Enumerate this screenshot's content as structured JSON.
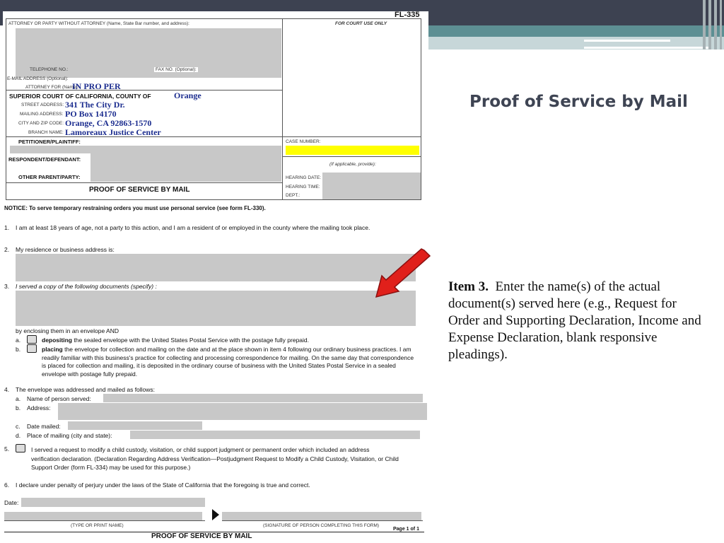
{
  "slide": {
    "title": "Proof of Service by Mail",
    "note_bold": "Item 3.",
    "note_text": "Enter the name(s) of the actual document(s) served here (e.g., Request for Order and Supporting Declaration, Income and Expense Declaration, blank responsive pleadings)."
  },
  "form": {
    "form_number": "FL-335",
    "header": {
      "attorney_label": "ATTORNEY OR PARTY WITHOUT ATTORNEY (Name, State Bar number, and address):",
      "court_use_label": "FOR COURT USE ONLY",
      "telephone_label": "TELEPHONE NO.:",
      "fax_label": "FAX NO. (Optional):",
      "email_label": "E-MAIL ADDRESS (Optional):",
      "attorney_for_label": "ATTORNEY FOR (Name):",
      "attorney_for_value": "IN PRO PER",
      "court_label": "SUPERIOR COURT OF CALIFORNIA, COUNTY OF",
      "county_value": "Orange",
      "street_label": "STREET ADDRESS:",
      "street_value": "341 The City Dr.",
      "mailing_label": "MAILING ADDRESS:",
      "mailing_value": "PO Box 14170",
      "city_label": "CITY AND ZIP CODE:",
      "city_value": "Orange, CA  92863-1570",
      "branch_label": "BRANCH NAME:",
      "branch_value": "Lamoreaux Justice Center",
      "petitioner_label": "PETITIONER/PLAINTIFF:",
      "respondent_label": "RESPONDENT/DEFENDANT:",
      "other_parent_label": "OTHER PARENT/PARTY:",
      "case_number_label": "CASE NUMBER:",
      "if_applicable": "(If applicable, provide):",
      "hearing_date_label": "HEARING DATE:",
      "hearing_time_label": "HEARING TIME:",
      "dept_label": "DEPT.:",
      "form_title": "PROOF OF SERVICE BY MAIL"
    },
    "notice": "NOTICE: To serve temporary restraining orders you must use personal service (see form FL-330).",
    "items": {
      "i1_num": "1.",
      "i1_text": "I am at least 18 years of age, not a party to this action, and I am a resident of or employed in the county where the mailing took place.",
      "i2_num": "2.",
      "i2_text": "My residence or business address is:",
      "i3_num": "3.",
      "i3_text": "I served a copy of the following documents (specify) :",
      "enclosing": "by enclosing them in an envelope AND",
      "a_label": "a.",
      "a_bold": "depositing",
      "a_text": "the sealed envelope with the United States Postal Service with the postage fully prepaid.",
      "b_label": "b.",
      "b_bold": "placing",
      "b_text": "the envelope for collection and mailing on the date and at the place shown in item 4 following our ordinary business practices. I am readily familiar with this business's practice for collecting and processing correspondence for mailing. On the same day that correspondence is placed for collection and mailing, it is deposited in the ordinary course of business with the United States Postal Service in a sealed envelope with postage fully prepaid.",
      "i4_num": "4.",
      "i4_text": "The envelope was addressed and mailed as follows:",
      "i4a": "a.",
      "i4a_text": "Name of person served:",
      "i4b": "b.",
      "i4b_text": "Address:",
      "i4c": "c.",
      "i4c_text": "Date mailed:",
      "i4d": "d.",
      "i4d_text": "Place of mailing (city and state):",
      "i5_num": "5.",
      "i5_text": "I served a request to modify a child custody, visitation, or child support judgment or permanent order which included an address verification declaration. (Declaration Regarding Address Verification—Postjudgment Request to Modify a Child Custody, Visitation, or Child Support Order (form FL-334) may be used for this purpose.)",
      "i6_num": "6.",
      "i6_text": "I declare under penalty of perjury under the laws of the State of California that the foregoing is true and correct."
    },
    "date_label": "Date:",
    "type_print": "(TYPE OR PRINT NAME)",
    "signature": "(SIGNATURE OF PERSON COMPLETING THIS FORM)",
    "page": "Page 1 of 1",
    "footer_title": "PROOF OF SERVICE BY MAIL"
  },
  "colors": {
    "title": "#3e4453",
    "band_dark": "#3d4251",
    "band_teal": "#5d8f93",
    "filled_text": "#1c2d8f",
    "highlight": "#ffff00",
    "arrow": "#e0201b"
  }
}
